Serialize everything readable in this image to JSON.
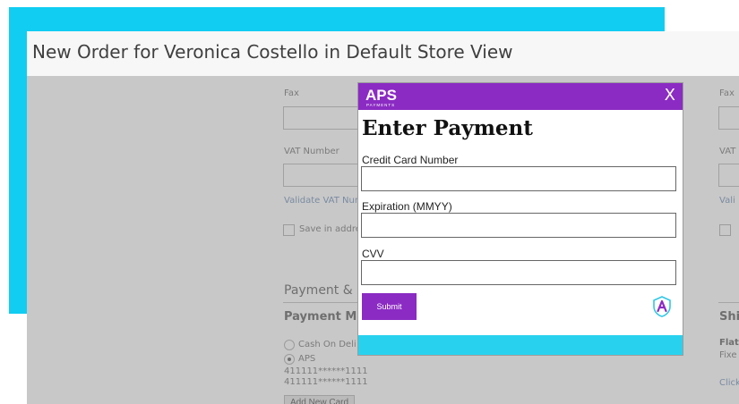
{
  "page": {
    "title": "New Order for Veronica Costello in Default Store View"
  },
  "form": {
    "fax_label": "Fax",
    "fax_label_right": "Fax",
    "vat_label": "VAT Number",
    "vat_label_right": "VAT",
    "validate_vat_link": "Validate VAT Num",
    "validate_vat_link_right": "Vali",
    "save_in_address_label": "Save in addre"
  },
  "payment_section": {
    "title": "Payment & S",
    "methods_title": "Payment Met",
    "methods": [
      {
        "label": "Cash On Deli",
        "selected": false
      },
      {
        "label": "APS",
        "selected": true
      }
    ],
    "saved_cards": [
      "411111******1111",
      "411111******1111"
    ],
    "add_card_label": "Add New Card"
  },
  "shipping_section": {
    "title": "Shi",
    "flat_label": "Flat",
    "fixed_label": "Fixe",
    "click_label": "Click"
  },
  "modal": {
    "logo_text": "APS",
    "logo_subtext": "PAYMENTS",
    "close_label": "X",
    "title": "Enter Payment",
    "card_number_label": "Credit Card Number",
    "card_number_value": "",
    "expiration_label": "Expiration (MMYY)",
    "expiration_value": "",
    "cvv_label": "CVV",
    "cvv_value": "",
    "submit_label": "Submit"
  },
  "colors": {
    "brand_purple": "#8b2bc3",
    "accent_cyan": "#11cdf2",
    "footer_cyan": "#28d2ef"
  },
  "icons": {
    "logo": "aps-payments-logo",
    "shield": "aps-shield-icon",
    "close": "close-icon"
  }
}
